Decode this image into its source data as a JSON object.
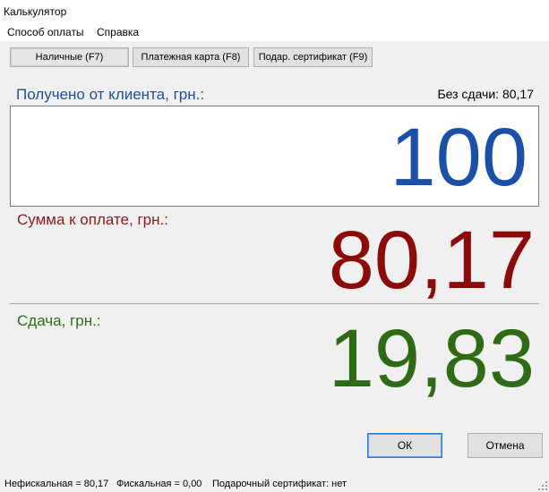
{
  "window": {
    "title": "Калькулятор"
  },
  "menu": {
    "payment": "Способ оплаты",
    "help": "Справка"
  },
  "tabs": [
    {
      "label": "Наличные (F7)",
      "active": true
    },
    {
      "label": "Платежная карта (F8)",
      "active": false
    },
    {
      "label": "Подар. сертификат (F9)",
      "active": false
    }
  ],
  "received": {
    "label": "Получено от клиента, грн.:",
    "value": "100"
  },
  "no_change": {
    "text": "Без сдачи: 80,17"
  },
  "due": {
    "label": "Сумма к оплате, грн.:",
    "value": "80,17"
  },
  "change": {
    "label": "Сдача, грн.:",
    "value": "19,83"
  },
  "buttons": {
    "ok": "ОК",
    "cancel": "Отмена"
  },
  "status": {
    "nonfiscal": "Нефискальная = 80,17",
    "fiscal": "Фискальная = 0,00",
    "certificate": "Подарочный сертификат: нет"
  },
  "colors": {
    "received": "#1b4fa8",
    "due": "#8b0b0b",
    "change": "#2f6b16"
  }
}
